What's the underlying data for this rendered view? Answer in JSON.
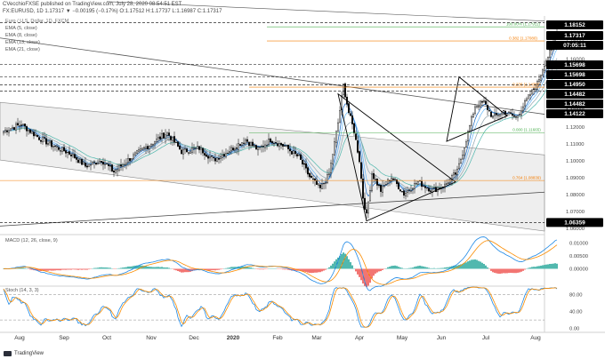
{
  "header": {
    "author_line": "CVecchioFXSE published on TradingView.com, July 28, 2020 08:54:51 EST",
    "symbol_line": "FX:EURUSD, 1D  1.17317  ▼ −0.00195 (−0.17%)  O:1.17512  H:1.17737  L:1.16987  C:1.17317"
  },
  "legend": {
    "title": "Euro / U.S. Dollar, 1D, FXCM",
    "items": [
      "EMA (5, close)",
      "EMA (8, close)",
      "EMA (13, close)",
      "EMA (21, close)"
    ]
  },
  "indicators": {
    "macd_label": "MACD (12, 26, close, 9)",
    "stoch_label": "Stoch (14, 3, 3)"
  },
  "footer": {
    "logo_text": "TradingView"
  },
  "colors": {
    "candle": "#000000",
    "ema5": "#1565c0",
    "ema8": "#64b5f6",
    "ema13": "#90a4ae",
    "ema21": "#4db6ac",
    "macd_line": "#1e88e5",
    "signal_line": "#fb8c00",
    "hist_up": "#26a69a",
    "hist_down": "#ef5350",
    "fib": "#f57c00",
    "fib_green": "#4caf50",
    "channel": "#e0e0e0",
    "price_tag": "#000000"
  },
  "chart_data": {
    "type": "candlestick",
    "symbol": "FX:EURUSD",
    "timeframe": "1D",
    "x_labels": [
      "Aug",
      "Sep",
      "Oct",
      "Nov",
      "Dec",
      "2020",
      "Feb",
      "Mar",
      "Apr",
      "May",
      "Jun",
      "Jul",
      "Aug"
    ],
    "y_ticks": [
      1.06,
      1.07,
      1.08,
      1.09,
      1.1,
      1.11,
      1.12,
      1.13,
      1.14,
      1.15,
      1.16,
      1.17,
      1.18
    ],
    "ylim": [
      1.0575,
      1.1855
    ],
    "price_levels": [
      {
        "value": 1.18152,
        "label": "1.18152"
      },
      {
        "value": 1.17317,
        "label": "1.17317",
        "highlight": true
      },
      {
        "label": "07:05:11",
        "timer": true
      },
      {
        "value": 1.15698,
        "label": "1.15698"
      },
      {
        "value": 1.15698,
        "label": "1.15698",
        "alt": true
      },
      {
        "value": 1.1495,
        "label": "1.14950"
      },
      {
        "value": 1.14482,
        "label": "1.14482"
      },
      {
        "value": 1.14482,
        "label": "1.14482",
        "alt": true
      },
      {
        "value": 1.14122,
        "label": "1.14122"
      },
      {
        "value": 1.06359,
        "label": "1.06359"
      }
    ],
    "fib_levels": [
      {
        "ratio": "100.00% (1.17911)",
        "value": 1.17911,
        "color": "green"
      },
      {
        "ratio": "0.382 (1.17080)",
        "value": 1.1708,
        "color": "orange"
      },
      {
        "ratio": "0.236 (1.14350)",
        "value": 1.1435,
        "color": "orange"
      },
      {
        "ratio": "0.000 (1.11665)",
        "value": 1.11665,
        "color": "green"
      },
      {
        "ratio": "0.764 (1.08839)",
        "value": 1.08839,
        "color": "orange"
      }
    ],
    "macd": {
      "y_ticks": [
        0.01,
        0.005,
        0.0
      ],
      "ylim": [
        -0.006,
        0.0125
      ]
    },
    "stoch": {
      "y_ticks": [
        80.0,
        40.0,
        0.0
      ],
      "ylim": [
        -5,
        100
      ]
    },
    "anchors": [
      {
        "t": 0,
        "c": 1.1176
      },
      {
        "t": 10,
        "c": 1.1215
      },
      {
        "t": 20,
        "c": 1.1135
      },
      {
        "t": 28,
        "c": 1.1088
      },
      {
        "t": 38,
        "c": 1.104
      },
      {
        "t": 46,
        "c": 1.0968
      },
      {
        "t": 55,
        "c": 1.1005
      },
      {
        "t": 62,
        "c": 1.0935
      },
      {
        "t": 70,
        "c": 1.1005
      },
      {
        "t": 78,
        "c": 1.1065
      },
      {
        "t": 84,
        "c": 1.1108
      },
      {
        "t": 92,
        "c": 1.1165
      },
      {
        "t": 100,
        "c": 1.1055
      },
      {
        "t": 110,
        "c": 1.1075
      },
      {
        "t": 118,
        "c": 1.1005
      },
      {
        "t": 126,
        "c": 1.1055
      },
      {
        "t": 136,
        "c": 1.1125
      },
      {
        "t": 143,
        "c": 1.1065
      },
      {
        "t": 150,
        "c": 1.1125
      },
      {
        "t": 158,
        "c": 1.1085
      },
      {
        "t": 166,
        "c": 1.102
      },
      {
        "t": 172,
        "c": 1.0905
      },
      {
        "t": 178,
        "c": 1.0835
      },
      {
        "t": 183,
        "c": 1.092
      },
      {
        "t": 188,
        "c": 1.1225
      },
      {
        "t": 191,
        "c": 1.1445
      },
      {
        "t": 194,
        "c": 1.1285
      },
      {
        "t": 197,
        "c": 1.1175
      },
      {
        "t": 200,
        "c": 1.1005
      },
      {
        "t": 202,
        "c": 1.0785
      },
      {
        "t": 204,
        "c": 1.0675
      },
      {
        "t": 207,
        "c": 1.0925
      },
      {
        "t": 212,
        "c": 1.0825
      },
      {
        "t": 218,
        "c": 1.0905
      },
      {
        "t": 225,
        "c": 1.0805
      },
      {
        "t": 233,
        "c": 1.0875
      },
      {
        "t": 241,
        "c": 1.0825
      },
      {
        "t": 248,
        "c": 1.0855
      },
      {
        "t": 255,
        "c": 1.0935
      },
      {
        "t": 260,
        "c": 1.1125
      },
      {
        "t": 265,
        "c": 1.1325
      },
      {
        "t": 270,
        "c": 1.1345
      },
      {
        "t": 275,
        "c": 1.1255
      },
      {
        "t": 281,
        "c": 1.1295
      },
      {
        "t": 288,
        "c": 1.1255
      },
      {
        "t": 295,
        "c": 1.1375
      },
      {
        "t": 300,
        "c": 1.1455
      },
      {
        "t": 304,
        "c": 1.1575
      },
      {
        "t": 308,
        "c": 1.1655
      },
      {
        "t": 310,
        "c": 1.1745
      },
      {
        "t": 311,
        "c": 1.1732
      }
    ]
  }
}
